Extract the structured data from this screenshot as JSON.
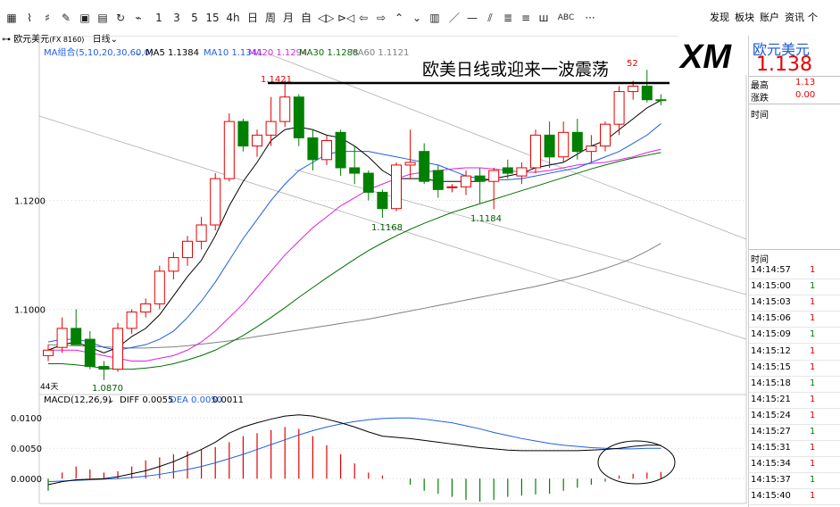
{
  "toolbar": {
    "icons": [
      "grid-icon",
      "line-chart-icon",
      "candle-icon",
      "draw-icon",
      "table-icon",
      "save-icon",
      "refresh-icon",
      "period-icon"
    ],
    "periods": [
      "1",
      "3",
      "5",
      "15",
      "4h",
      "日",
      "周",
      "月",
      "自"
    ],
    "nav_icons": [
      "◁▷",
      "⊳◁",
      "⇦",
      "⇨",
      "⌃",
      "⌄",
      "▥",
      "／",
      "—",
      "⫽",
      "≣",
      "≡",
      "ш",
      "ABC",
      "···"
    ],
    "right_menu": [
      "发现",
      "板块",
      "账户",
      "资讯",
      "个"
    ]
  },
  "subbar": {
    "instrument": "欧元美元",
    "code": "(FX 8160)",
    "period": "日线"
  },
  "ma_legend": {
    "group": "MA组合(5,10,20,30,60,0)",
    "ma5": "MA5 1.1384",
    "ma10": "MA10 1.1341",
    "ma20": "MA20 1.1294",
    "ma30": "MA30 1.1288",
    "ma60": "MA60 1.1121"
  },
  "annotation": {
    "headline": "欧美日线或迎来一波震荡",
    "high_label": "1.1421",
    "top_right_label": "52",
    "low1_label": "1.1168",
    "low2_label": "1.1184",
    "bottom_low_label": "1.0870",
    "days_label": "44天"
  },
  "y_axis": [
    "1.1200",
    "1.1000"
  ],
  "macd_legend": {
    "name": "MACD(12,26,9)",
    "diff": "DIFF 0.0055",
    "dea": "DEA 0.0050",
    "macd": "0.0011"
  },
  "macd_axis": [
    "0.0100",
    "0.0050",
    "0.0000"
  ],
  "colors": {
    "up": "#e60000",
    "down": "#008000",
    "ma5": "#000000",
    "ma10": "#1f5fe0",
    "ma20": "#e020e0",
    "ma30": "#007000",
    "ma60": "#808080"
  },
  "logo": {
    "text": "XM"
  },
  "side": {
    "title": "欧元美元",
    "price": "1.138",
    "high_label": "最高",
    "high_val": "1.13",
    "chg_label": "涨跌",
    "chg_val": "0.00",
    "time_header": "时间",
    "tick_header": "时间",
    "ticks": [
      "14:14:57",
      "14:15:00",
      "14:15:03",
      "14:15:06",
      "14:15:09",
      "14:15:12",
      "14:15:15",
      "14:15:18",
      "14:15:21",
      "14:15:24",
      "14:15:27",
      "14:15:31",
      "14:15:34",
      "14:15:37",
      "14:15:40"
    ],
    "tick_flags": [
      "1",
      "1",
      "1",
      "1",
      "1",
      "1",
      "1",
      "1",
      "1",
      "1",
      "1",
      "1",
      "1",
      "1",
      "1"
    ]
  },
  "chart_data": {
    "type": "candlestick",
    "candles": [
      {
        "o": 1.0915,
        "h": 1.0935,
        "l": 1.0905,
        "c": 1.0925
      },
      {
        "o": 1.093,
        "h": 1.0985,
        "l": 1.092,
        "c": 1.0965
      },
      {
        "o": 1.0965,
        "h": 1.1,
        "l": 1.094,
        "c": 1.0935
      },
      {
        "o": 1.0945,
        "h": 1.096,
        "l": 1.089,
        "c": 1.0895
      },
      {
        "o": 1.0895,
        "h": 1.0905,
        "l": 1.087,
        "c": 1.089
      },
      {
        "o": 1.089,
        "h": 1.0975,
        "l": 1.0885,
        "c": 1.0965
      },
      {
        "o": 1.0965,
        "h": 1.1,
        "l": 1.0955,
        "c": 1.0995
      },
      {
        "o": 1.0995,
        "h": 1.102,
        "l": 1.0985,
        "c": 1.101
      },
      {
        "o": 1.101,
        "h": 1.108,
        "l": 1.1,
        "c": 1.107
      },
      {
        "o": 1.107,
        "h": 1.1105,
        "l": 1.1055,
        "c": 1.1095
      },
      {
        "o": 1.1095,
        "h": 1.1135,
        "l": 1.108,
        "c": 1.1125
      },
      {
        "o": 1.1125,
        "h": 1.117,
        "l": 1.111,
        "c": 1.1155
      },
      {
        "o": 1.1155,
        "h": 1.125,
        "l": 1.1145,
        "c": 1.124
      },
      {
        "o": 1.124,
        "h": 1.136,
        "l": 1.1235,
        "c": 1.1345
      },
      {
        "o": 1.1345,
        "h": 1.135,
        "l": 1.129,
        "c": 1.13
      },
      {
        "o": 1.13,
        "h": 1.133,
        "l": 1.128,
        "c": 1.132
      },
      {
        "o": 1.132,
        "h": 1.139,
        "l": 1.13,
        "c": 1.1345
      },
      {
        "o": 1.1345,
        "h": 1.1421,
        "l": 1.1335,
        "c": 1.139
      },
      {
        "o": 1.139,
        "h": 1.1395,
        "l": 1.13,
        "c": 1.1315
      },
      {
        "o": 1.1315,
        "h": 1.133,
        "l": 1.1255,
        "c": 1.1275
      },
      {
        "o": 1.1275,
        "h": 1.132,
        "l": 1.1265,
        "c": 1.131
      },
      {
        "o": 1.1325,
        "h": 1.133,
        "l": 1.1245,
        "c": 1.126
      },
      {
        "o": 1.126,
        "h": 1.13,
        "l": 1.123,
        "c": 1.125
      },
      {
        "o": 1.125,
        "h": 1.1255,
        "l": 1.12,
        "c": 1.1215
      },
      {
        "o": 1.1215,
        "h": 1.122,
        "l": 1.1168,
        "c": 1.1185
      },
      {
        "o": 1.1185,
        "h": 1.127,
        "l": 1.118,
        "c": 1.1265
      },
      {
        "o": 1.1265,
        "h": 1.133,
        "l": 1.124,
        "c": 1.127
      },
      {
        "o": 1.129,
        "h": 1.1305,
        "l": 1.123,
        "c": 1.1235
      },
      {
        "o": 1.1255,
        "h": 1.1265,
        "l": 1.1205,
        "c": 1.122
      },
      {
        "o": 1.1225,
        "h": 1.123,
        "l": 1.1215,
        "c": 1.1225
      },
      {
        "o": 1.1225,
        "h": 1.1255,
        "l": 1.121,
        "c": 1.1245
      },
      {
        "o": 1.1245,
        "h": 1.126,
        "l": 1.1195,
        "c": 1.1235
      },
      {
        "o": 1.1235,
        "h": 1.126,
        "l": 1.1184,
        "c": 1.1255
      },
      {
        "o": 1.126,
        "h": 1.1275,
        "l": 1.124,
        "c": 1.125
      },
      {
        "o": 1.1245,
        "h": 1.127,
        "l": 1.123,
        "c": 1.126
      },
      {
        "o": 1.126,
        "h": 1.133,
        "l": 1.125,
        "c": 1.132
      },
      {
        "o": 1.132,
        "h": 1.1345,
        "l": 1.126,
        "c": 1.128
      },
      {
        "o": 1.128,
        "h": 1.1345,
        "l": 1.127,
        "c": 1.1325
      },
      {
        "o": 1.1325,
        "h": 1.135,
        "l": 1.1275,
        "c": 1.129
      },
      {
        "o": 1.129,
        "h": 1.132,
        "l": 1.127,
        "c": 1.13
      },
      {
        "o": 1.13,
        "h": 1.1345,
        "l": 1.129,
        "c": 1.134
      },
      {
        "o": 1.134,
        "h": 1.141,
        "l": 1.132,
        "c": 1.14
      },
      {
        "o": 1.14,
        "h": 1.142,
        "l": 1.1385,
        "c": 1.141
      },
      {
        "o": 1.141,
        "h": 1.144,
        "l": 1.138,
        "c": 1.1385
      },
      {
        "o": 1.1385,
        "h": 1.1395,
        "l": 1.1375,
        "c": 1.1384
      }
    ],
    "ma5": [
      1.0925,
      1.0935,
      1.094,
      1.093,
      1.092,
      1.093,
      1.095,
      1.0965,
      1.099,
      1.1025,
      1.106,
      1.109,
      1.1135,
      1.119,
      1.1235,
      1.127,
      1.131,
      1.133,
      1.1335,
      1.133,
      1.132,
      1.1315,
      1.13,
      1.128,
      1.1255,
      1.124,
      1.124,
      1.124,
      1.1235,
      1.1235,
      1.1235,
      1.1235,
      1.124,
      1.1245,
      1.125,
      1.126,
      1.1265,
      1.127,
      1.1285,
      1.13,
      1.131,
      1.133,
      1.135,
      1.137,
      1.1384
    ],
    "ma10": [
      1.094,
      1.0945,
      1.0945,
      1.094,
      1.093,
      1.0925,
      1.093,
      1.0935,
      1.0945,
      1.096,
      1.0985,
      1.1015,
      1.105,
      1.109,
      1.113,
      1.1165,
      1.12,
      1.123,
      1.1255,
      1.127,
      1.1285,
      1.129,
      1.129,
      1.129,
      1.1285,
      1.128,
      1.1275,
      1.127,
      1.1265,
      1.1255,
      1.1245,
      1.124,
      1.1238,
      1.1238,
      1.124,
      1.1245,
      1.125,
      1.1255,
      1.126,
      1.127,
      1.128,
      1.129,
      1.1305,
      1.132,
      1.1341
    ],
    "ma20": [
      1.0925,
      1.0925,
      1.0925,
      1.092,
      1.0915,
      1.091,
      1.0905,
      1.0905,
      1.091,
      1.0915,
      1.0925,
      1.094,
      1.096,
      1.0985,
      1.101,
      1.104,
      1.107,
      1.11,
      1.1125,
      1.115,
      1.117,
      1.119,
      1.1205,
      1.122,
      1.123,
      1.124,
      1.1248,
      1.1252,
      1.1255,
      1.1258,
      1.126,
      1.126,
      1.1258,
      1.1255,
      1.1252,
      1.1252,
      1.1255,
      1.126,
      1.1265,
      1.1268,
      1.127,
      1.1275,
      1.128,
      1.1288,
      1.1294
    ],
    "ma30": [
      1.09,
      1.09,
      1.0898,
      1.0895,
      1.0892,
      1.089,
      1.089,
      1.0892,
      1.0895,
      1.09,
      1.0907,
      1.0915,
      1.0925,
      1.0938,
      1.0952,
      1.0968,
      1.0985,
      1.1003,
      1.1022,
      1.104,
      1.1058,
      1.1075,
      1.1092,
      1.1108,
      1.1122,
      1.1135,
      1.1147,
      1.1158,
      1.1168,
      1.1178,
      1.1186,
      1.1194,
      1.1202,
      1.121,
      1.1218,
      1.1226,
      1.1234,
      1.1242,
      1.125,
      1.1258,
      1.1265,
      1.1272,
      1.1278,
      1.1283,
      1.1288
    ],
    "ma60": [
      1.0935,
      1.0934,
      1.0933,
      1.0932,
      1.0931,
      1.093,
      1.0929,
      1.0929,
      1.093,
      1.0931,
      1.0933,
      1.0936,
      1.0939,
      1.0942,
      1.0946,
      1.095,
      1.0954,
      1.0958,
      1.0962,
      1.0966,
      1.097,
      1.0974,
      1.0978,
      1.0982,
      1.0987,
      1.0992,
      1.0997,
      1.1002,
      1.1007,
      1.1012,
      1.1017,
      1.1022,
      1.1027,
      1.1032,
      1.1037,
      1.1042,
      1.1048,
      1.1054,
      1.106,
      1.1067,
      1.1075,
      1.1084,
      1.1094,
      1.1107,
      1.1121
    ],
    "macd_diff": [
      -0.001,
      -0.0005,
      -0.0002,
      -0.0001,
      0.0,
      0.0003,
      0.0008,
      0.0013,
      0.002,
      0.0028,
      0.0038,
      0.0048,
      0.006,
      0.0075,
      0.0085,
      0.0092,
      0.0098,
      0.0103,
      0.0105,
      0.0103,
      0.0098,
      0.0092,
      0.0085,
      0.0077,
      0.007,
      0.0068,
      0.0066,
      0.0063,
      0.006,
      0.0057,
      0.0054,
      0.0051,
      0.0049,
      0.0047,
      0.0046,
      0.0046,
      0.0046,
      0.0046,
      0.0046,
      0.0047,
      0.0048,
      0.005,
      0.0053,
      0.0055,
      0.0055
    ],
    "macd_dea": [
      -0.0005,
      -0.0004,
      -0.0003,
      -0.0002,
      -0.0001,
      0.0,
      0.0002,
      0.0004,
      0.0007,
      0.0011,
      0.0015,
      0.002,
      0.0026,
      0.0033,
      0.004,
      0.0048,
      0.0056,
      0.0064,
      0.0072,
      0.0079,
      0.0085,
      0.009,
      0.0094,
      0.0097,
      0.0099,
      0.01,
      0.01,
      0.0098,
      0.0095,
      0.0092,
      0.0087,
      0.0082,
      0.0076,
      0.0071,
      0.0066,
      0.0062,
      0.0058,
      0.0055,
      0.0053,
      0.0051,
      0.005,
      0.0049,
      0.0049,
      0.005,
      0.005
    ],
    "macd_hist": [
      -0.002,
      0.001,
      0.002,
      0.0015,
      0.001,
      0.0012,
      0.002,
      0.003,
      0.0035,
      0.004,
      0.0045,
      0.0048,
      0.0052,
      0.006,
      0.007,
      0.0075,
      0.008,
      0.0085,
      0.0082,
      0.007,
      0.0055,
      0.004,
      0.0025,
      0.001,
      0.0005,
      0.0,
      -0.001,
      -0.002,
      -0.0025,
      -0.003,
      -0.0035,
      -0.0038,
      -0.0035,
      -0.003,
      -0.0028,
      -0.0026,
      -0.0025,
      -0.002,
      -0.0015,
      -0.001,
      -0.0005,
      0.0005,
      0.0008,
      0.001,
      0.0011
    ],
    "ylim_price": [
      1.085,
      1.146
    ],
    "ylim_macd": [
      -0.0035,
      0.0115
    ]
  }
}
